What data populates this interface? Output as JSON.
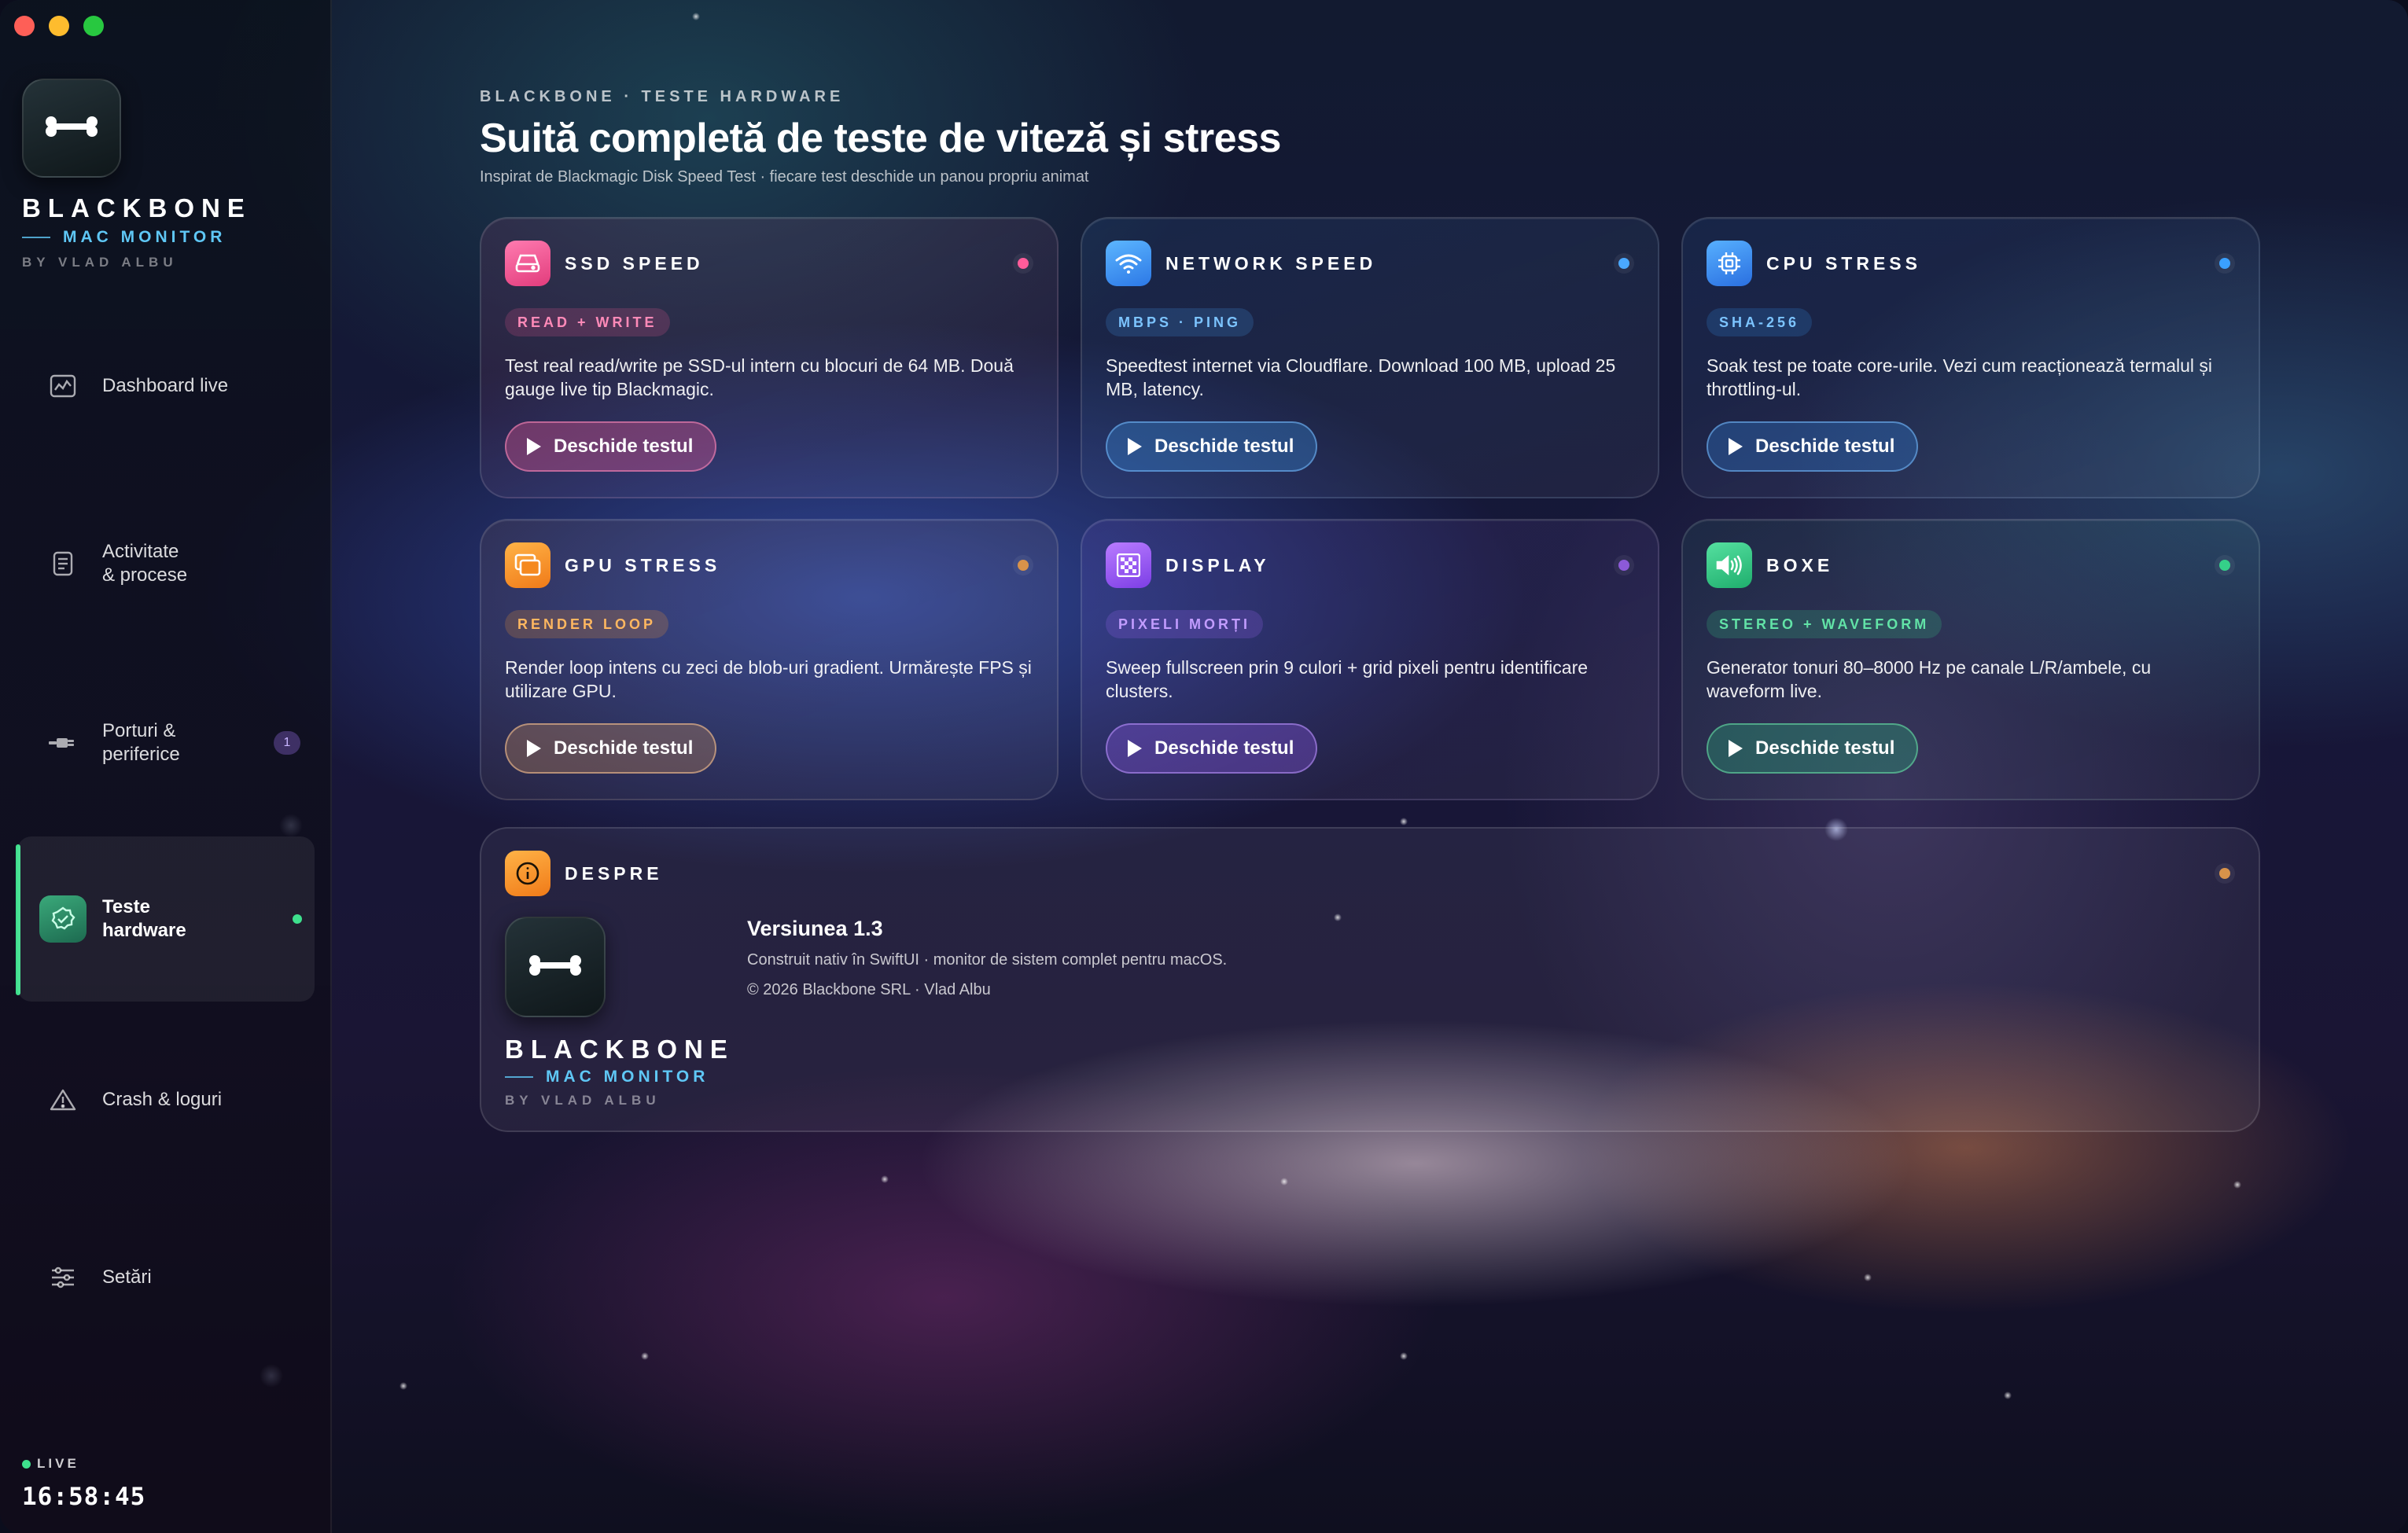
{
  "window": {
    "controls": [
      "close",
      "minimize",
      "zoom"
    ]
  },
  "sidebar": {
    "brand": {
      "name": "BLACKBONE",
      "subtitle": "MAC MONITOR",
      "by": "BY VLAD ALBU",
      "logo_icon": "bone-icon"
    },
    "items": [
      {
        "label": "Dashboard live",
        "icon": "chart-icon",
        "active": false
      },
      {
        "label": "Activitate\n& procese",
        "icon": "document-icon",
        "active": false
      },
      {
        "label": "Porturi &\nperiferice",
        "icon": "plug-icon",
        "active": false,
        "badge": "1"
      },
      {
        "label": "Teste\nhardware",
        "icon": "check-badge-icon",
        "active": true
      },
      {
        "label": "Crash & loguri",
        "icon": "warning-icon",
        "active": false
      },
      {
        "label": "Setări",
        "icon": "sliders-icon",
        "active": false
      }
    ],
    "status": {
      "live_label": "LIVE",
      "clock": "16:58:45"
    }
  },
  "header": {
    "eyebrow": "BLACKBONE · TESTE HARDWARE",
    "title": "Suită completă de teste de viteză și stress",
    "subtitle": "Inspirat de Blackmagic Disk Speed Test · fiecare test deschide un panou propriu animat"
  },
  "cards": [
    {
      "title": "SSD SPEED",
      "icon": "drive-icon",
      "tag": "READ + WRITE",
      "description": "Test real read/write pe SSD-ul intern cu blocuri de 64 MB. Două gauge live tip Blackmagic.",
      "button": "Deschide testul",
      "accent": "#ff5c9a"
    },
    {
      "title": "NETWORK SPEED",
      "icon": "wifi-icon",
      "tag": "MBPS · PING",
      "description": "Speedtest internet via Cloudflare. Download 100 MB, upload 25 MB, latency.",
      "button": "Deschide testul",
      "accent": "#4aa8ff"
    },
    {
      "title": "CPU STRESS",
      "icon": "cpu-icon",
      "tag": "SHA-256",
      "description": "Soak test pe toate core-urile. Vezi cum reacționează termalul și throttling-ul.",
      "button": "Deschide testul",
      "accent": "#3aa0ff"
    },
    {
      "title": "GPU STRESS",
      "icon": "gpu-icon",
      "tag": "RENDER LOOP",
      "description": "Render loop intens cu zeci de blob-uri gradient. Urmărește FPS și utilizare GPU.",
      "button": "Deschide testul",
      "accent": "#ff9a2e"
    },
    {
      "title": "DISPLAY",
      "icon": "checkerboard-icon",
      "tag": "PIXELI MORȚI",
      "description": "Sweep fullscreen prin 9 culori + grid pixeli pentru identificare clusters.",
      "button": "Deschide testul",
      "accent": "#a66bff"
    },
    {
      "title": "BOXE",
      "icon": "speaker-icon",
      "tag": "STEREO + WAVEFORM",
      "description": "Generator tonuri 80–8000 Hz pe canale L/R/ambele, cu waveform live.",
      "button": "Deschide testul",
      "accent": "#35d089"
    }
  ],
  "about": {
    "title": "DESPRE",
    "icon": "info-icon",
    "version": "Versiunea 1.3",
    "line1": "Construit nativ în SwiftUI · monitor de sistem complet pentru macOS.",
    "line2": "© 2026 Blackbone SRL · Vlad Albu",
    "brand": {
      "name": "BLACKBONE",
      "subtitle": "MAC MONITOR",
      "by": "BY VLAD ALBU"
    }
  }
}
